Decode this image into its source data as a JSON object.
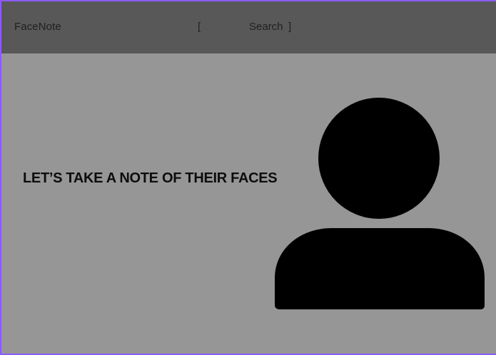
{
  "header": {
    "brand": "FaceNote",
    "search": {
      "open_bracket": "[",
      "label": "Search",
      "close_bracket": "]"
    }
  },
  "hero": {
    "title": "LET’S TAKE A NOTE OF THEIR FACES",
    "illustration_icon": "person-silhouette-icon"
  },
  "colors": {
    "page_background": "#969696",
    "header_background": "#585858",
    "frame_border": "#8b5cf6",
    "text": "#0d0d0d",
    "avatar": "#000000"
  }
}
